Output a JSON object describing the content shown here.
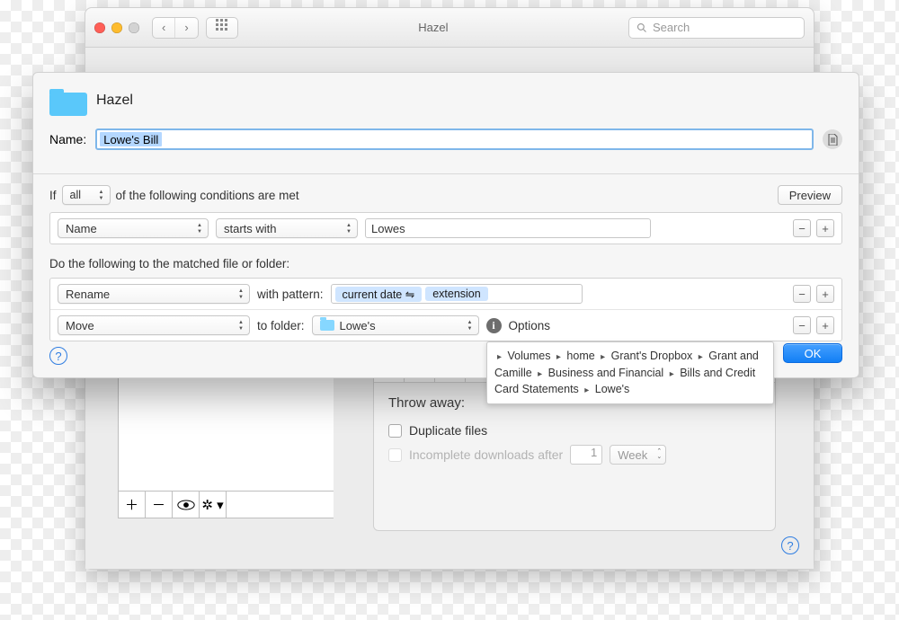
{
  "window": {
    "title": "Hazel",
    "search_placeholder": "Search"
  },
  "sheet": {
    "folder_name": "Hazel",
    "name_label": "Name:",
    "rule_name": "Lowe's Bill",
    "if_prefix": "If",
    "if_mode": "all",
    "if_suffix": "of the following conditions are met",
    "preview_label": "Preview",
    "conditions": [
      {
        "attribute": "Name",
        "operator": "starts with",
        "value": "Lowes"
      }
    ],
    "actions_header": "Do the following to the matched file or folder:",
    "actions": [
      {
        "verb": "Rename",
        "pattern_label": "with pattern:",
        "tokens": [
          "current date ⇋",
          "extension"
        ]
      },
      {
        "verb": "Move",
        "folder_label": "to folder:",
        "folder_name": "Lowe's",
        "options_label": "Options"
      }
    ],
    "breadcrumbs": [
      "Volumes",
      "home",
      "Grant's Dropbox",
      "Grant and Camille",
      "Business and Financial",
      "Bills and Credit Card Statements",
      "Lowe's"
    ],
    "ok_label": "OK"
  },
  "back": {
    "throw_header": "Throw away:",
    "dup_label": "Duplicate files",
    "incomplete_label": "Incomplete downloads after",
    "incomplete_value": "1",
    "incomplete_unit": "Week"
  }
}
